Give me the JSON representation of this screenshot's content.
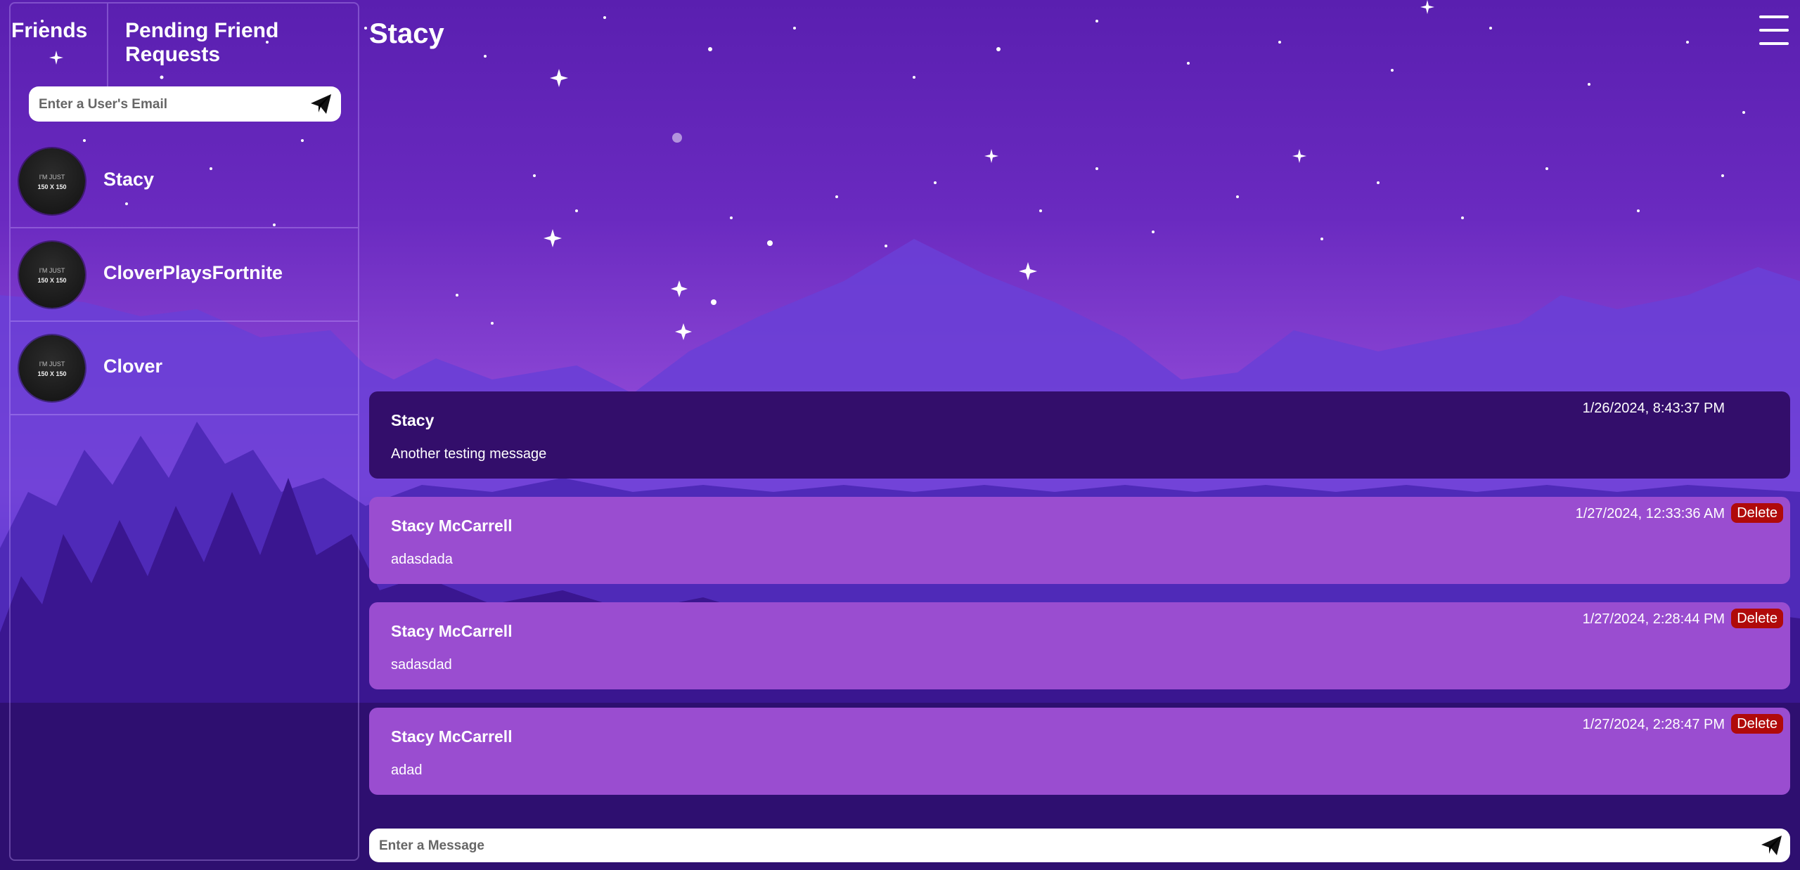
{
  "sidebar": {
    "tabs": {
      "friends": "Friends",
      "pending": "Pending Friend Requests"
    },
    "email_placeholder": "Enter a User's Email",
    "friends": [
      {
        "name": "Stacy",
        "avatar_line1": "I'M JUST",
        "avatar_line2": "150 X 150"
      },
      {
        "name": "CloverPlaysFortnite",
        "avatar_line1": "I'M JUST",
        "avatar_line2": "150 X 150"
      },
      {
        "name": "Clover",
        "avatar_line1": "I'M JUST",
        "avatar_line2": "150 X 150"
      }
    ]
  },
  "chat": {
    "title": "Stacy",
    "messages": [
      {
        "author": "Stacy",
        "timestamp": "1/26/2024, 8:43:37 PM",
        "text": "Another testing message"
      },
      {
        "author": "Stacy McCarrell",
        "timestamp": "1/27/2024, 12:33:36 AM",
        "text": "adasdada",
        "delete_label": "Delete"
      },
      {
        "author": "Stacy McCarrell",
        "timestamp": "1/27/2024, 2:28:44 PM",
        "text": "sadasdad",
        "delete_label": "Delete"
      },
      {
        "author": "Stacy McCarrell",
        "timestamp": "1/27/2024, 2:28:47 PM",
        "text": "adad",
        "delete_label": "Delete"
      }
    ],
    "message_placeholder": "Enter a Message"
  },
  "colors": {
    "other_message_bg": "#330e6b",
    "own_message_bg": "#9a4dd0",
    "delete_button_bg": "#b00a0a"
  },
  "icons": {
    "send": "paper-plane-icon",
    "menu": "hamburger-menu-icon"
  }
}
